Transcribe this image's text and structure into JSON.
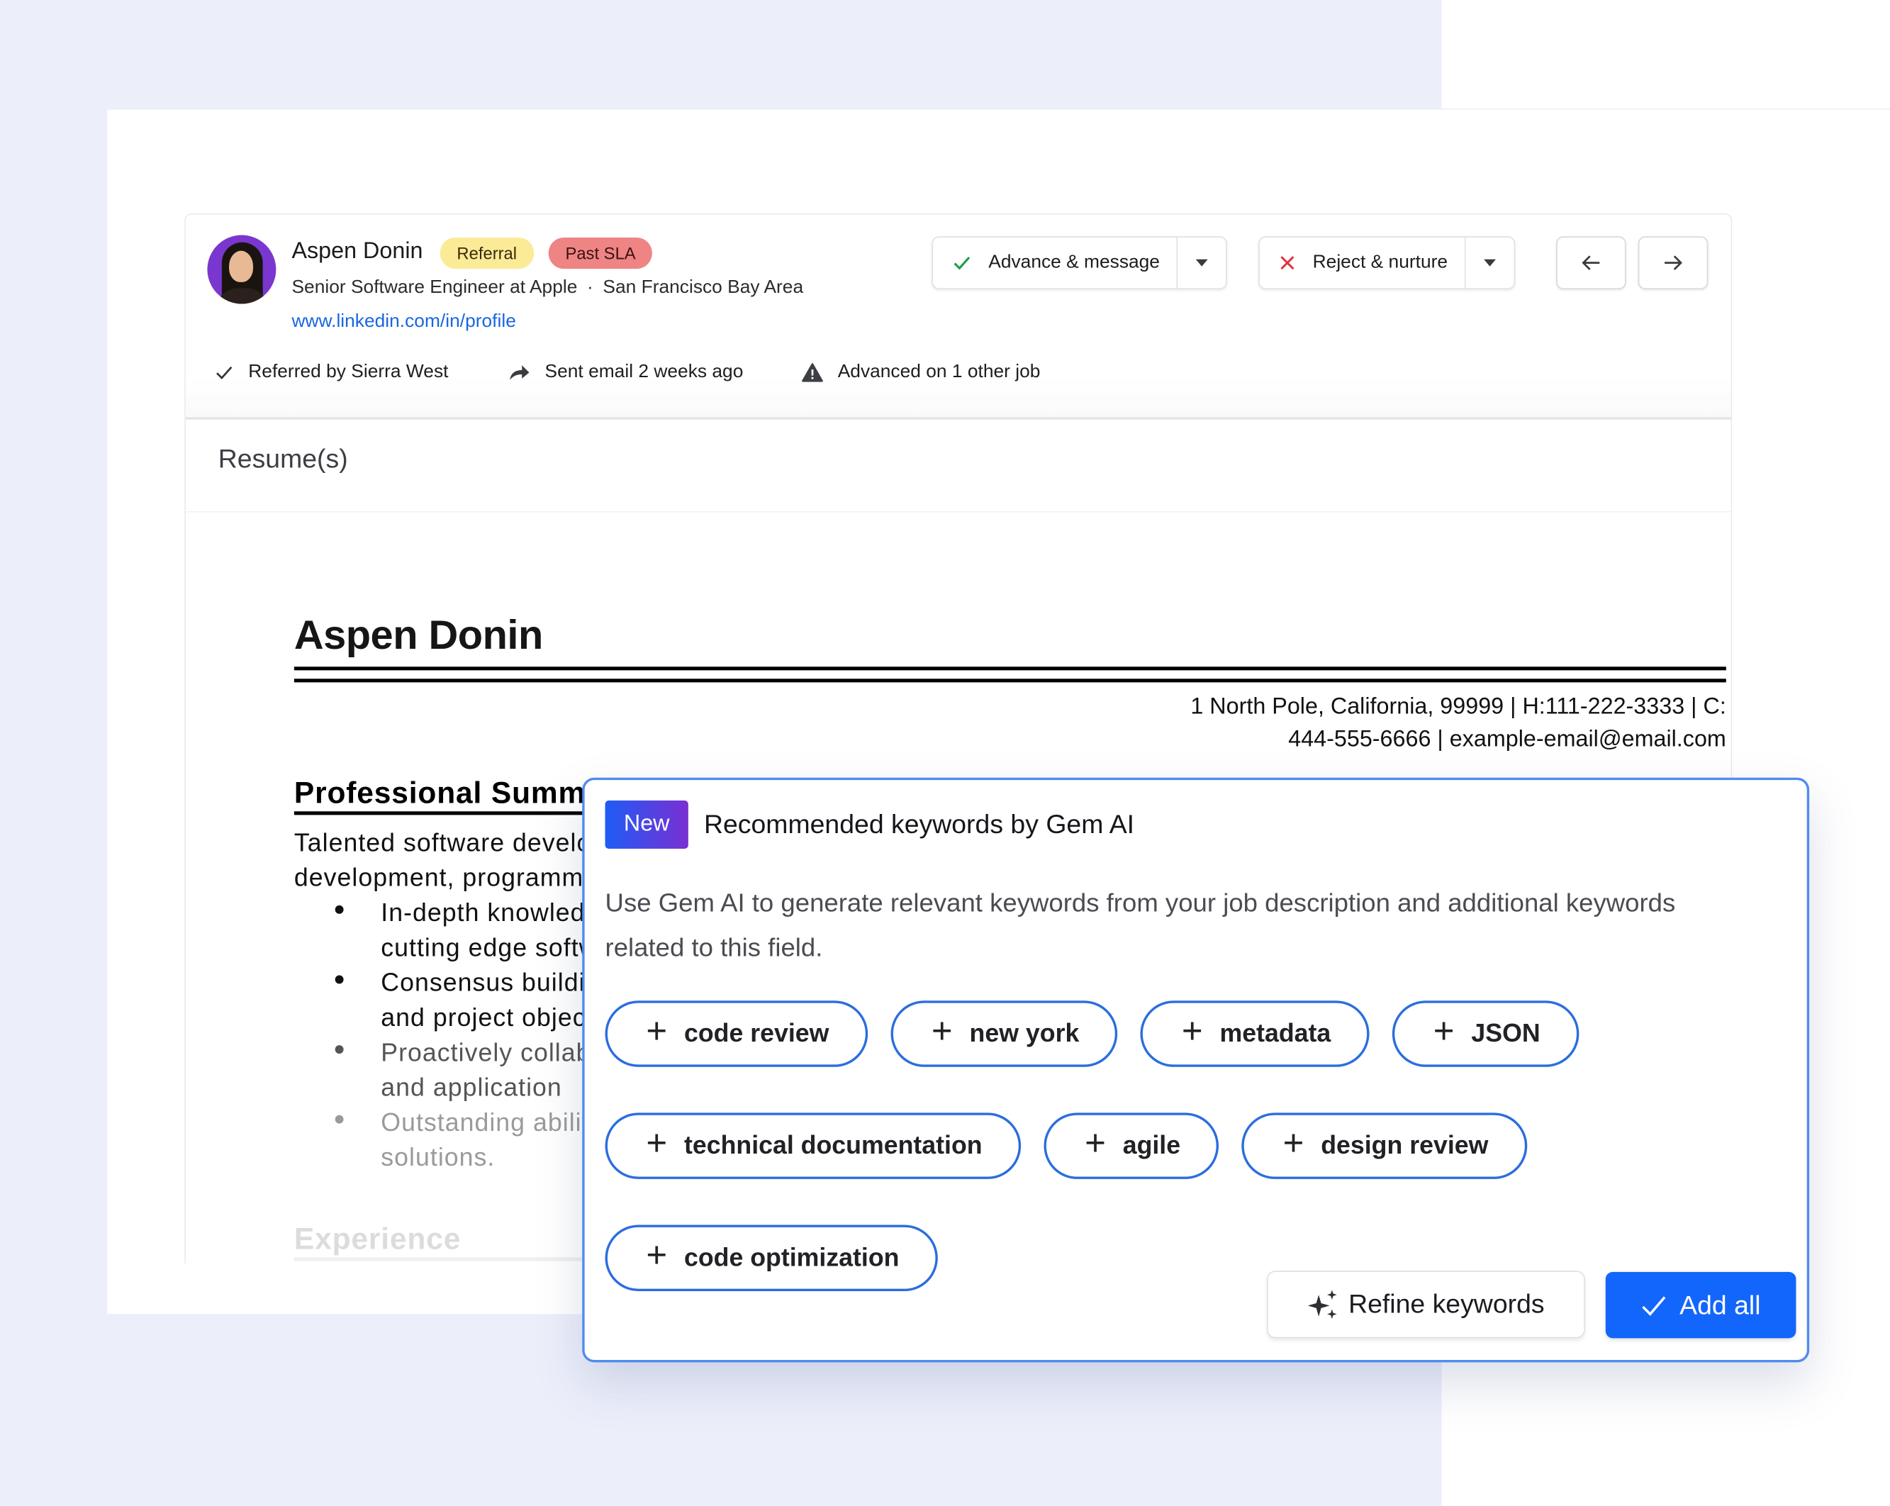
{
  "candidate": {
    "name": "Aspen Donin",
    "badges": [
      {
        "label": "Referral",
        "color": "#fbeb97"
      },
      {
        "label": "Past SLA",
        "color": "#ef8484"
      }
    ],
    "title": "Senior Software Engineer at Apple",
    "separator": "·",
    "location": "San Francisco Bay Area",
    "profile_link": "www.linkedin.com/in/profile",
    "meta": [
      {
        "icon": "check-icon",
        "text": "Referred by Sierra West"
      },
      {
        "icon": "share-arrow-icon",
        "text": "Sent email 2 weeks ago"
      },
      {
        "icon": "warning-icon",
        "text": "Advanced on 1 other job"
      }
    ]
  },
  "actions": {
    "advance_label": "Advance & message",
    "reject_label": "Reject & nurture",
    "prev_icon": "arrow-left-icon",
    "next_icon": "arrow-right-icon"
  },
  "resume": {
    "section_title": "Resume(s)",
    "doc_name": "Aspen Donin",
    "contact_line1": "1 North Pole, California, 99999 | H:111-222-3333 | C:",
    "contact_line2": "444-555-6666 | example-email@email.com",
    "summary_heading": "Professional Summary",
    "summary_lines": [
      "Talented software developer",
      "development, programming"
    ],
    "bullets": [
      {
        "line1": "In-depth knowledge",
        "line2": "cutting edge software",
        "shade": "#111111"
      },
      {
        "line1": "Consensus building",
        "line2": "and project objectives",
        "shade": "#111111"
      },
      {
        "line1": "Proactively collaborate",
        "line2": "and application",
        "shade": "#555555"
      },
      {
        "line1": "Outstanding ability",
        "line2": "solutions.",
        "shade": "#9a9a9a"
      }
    ],
    "experience_heading": "Experience"
  },
  "keywords_panel": {
    "new_badge": "New",
    "title": "Recommended keywords by Gem AI",
    "description": "Use Gem AI to generate relevant keywords from your job description and additional keywords related to this field.",
    "keywords": [
      "code review",
      "new york",
      "metadata",
      "JSON",
      "technical documentation",
      "agile",
      "design review",
      "code optimization"
    ],
    "refine_label": "Refine keywords",
    "add_all_label": "Add all",
    "accent_color": "#1366fb"
  }
}
